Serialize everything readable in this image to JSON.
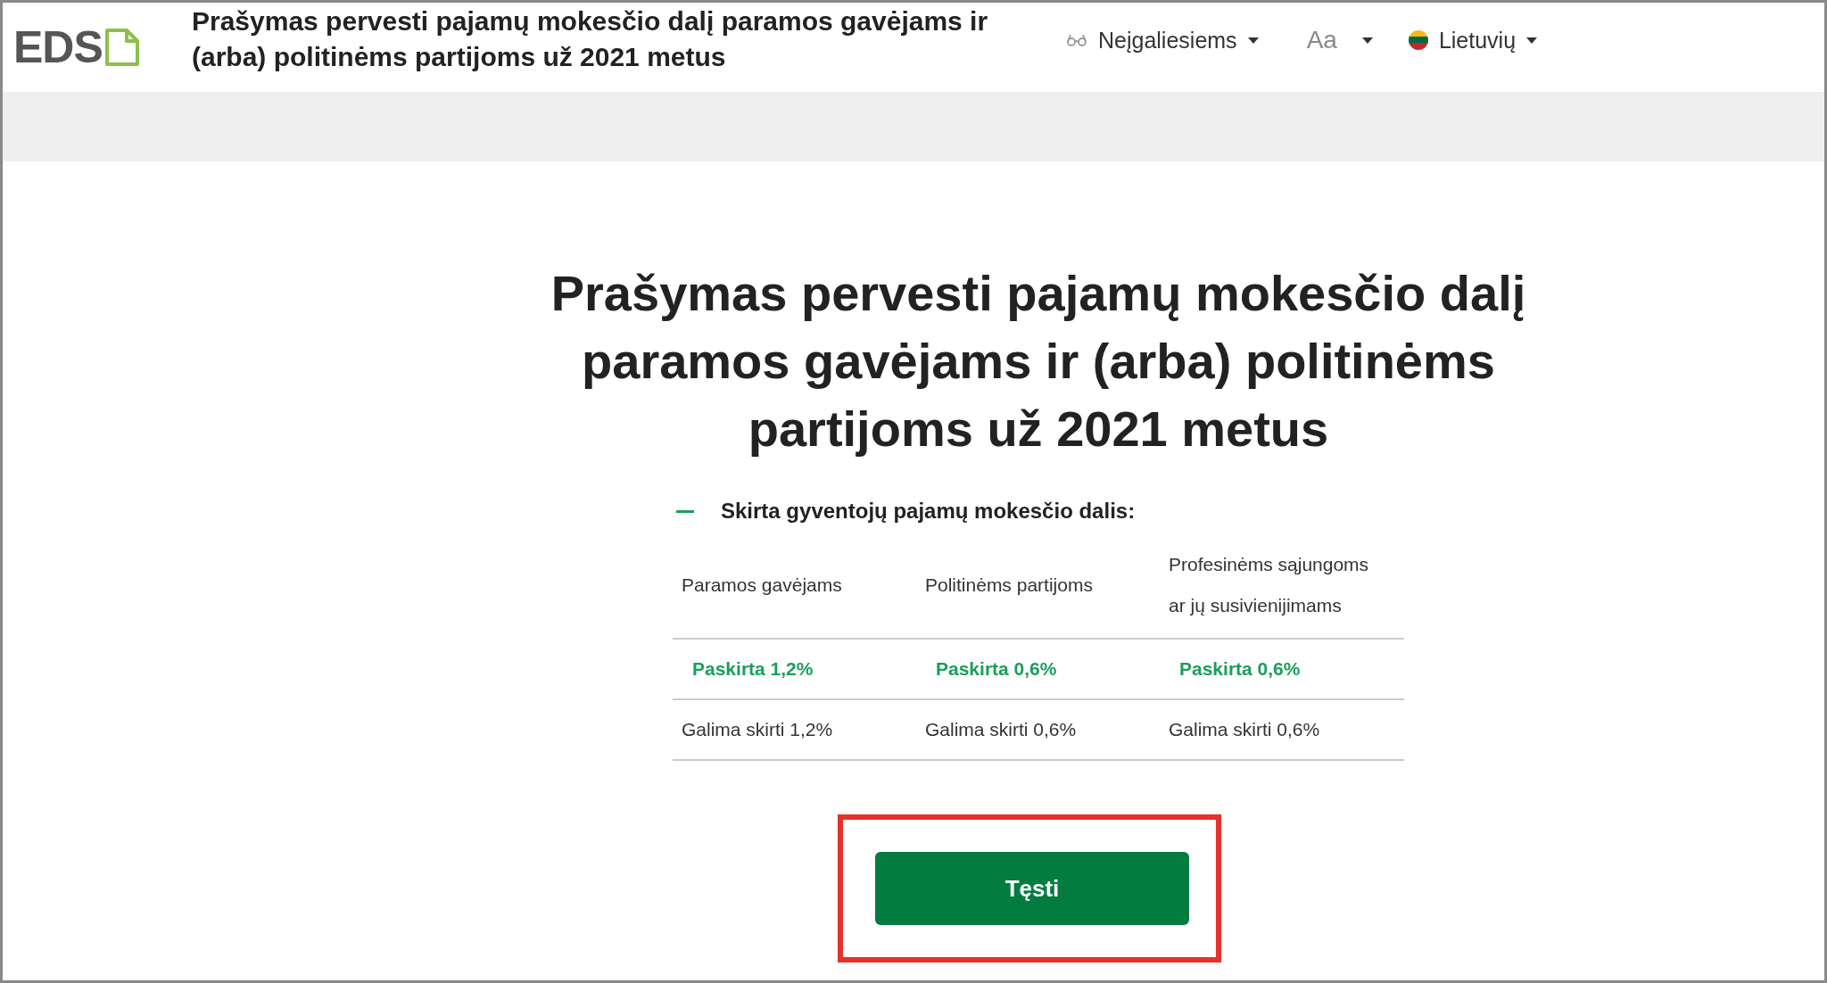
{
  "header": {
    "logo": "EDS",
    "title": "Prašymas pervesti pajamų mokesčio dalį paramos gavėjams ir (arba) politinėms partijoms už 2021 metus",
    "menus": [
      {
        "kind": "accessibility",
        "label": "Neįgaliesiems"
      },
      {
        "kind": "font-size",
        "label": "Aa"
      },
      {
        "kind": "language",
        "label": "Lietuvių"
      }
    ]
  },
  "main": {
    "title": "Prašymas pervesti pajamų mokesčio dalį paramos gavėjams ir (arba) politinėms partijoms už 2021 metus",
    "section": {
      "heading": "Skirta gyventojų pajamų mokesčio dalis:",
      "columns": [
        "Paramos gavėjams",
        "Politinėms partijoms",
        "Profesinėms sąjungoms ar jų susivienijimams"
      ],
      "rows": [
        {
          "kind": "assigned",
          "cells": [
            "Paskirta 1,2%",
            "Paskirta 0,6%",
            "Paskirta 0,6%"
          ]
        },
        {
          "kind": "available",
          "cells": [
            "Galima skirti 1,2%",
            "Galima skirti 0,6%",
            "Galima skirti 0,6%"
          ]
        }
      ]
    },
    "button": "Tęsti"
  }
}
